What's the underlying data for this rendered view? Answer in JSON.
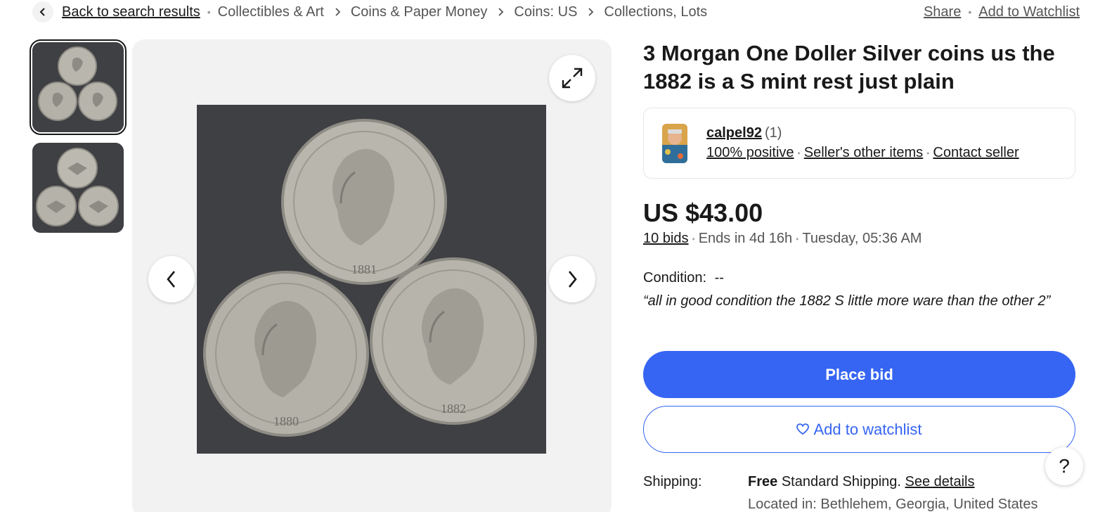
{
  "breadcrumb": {
    "back_label": "Back to search results",
    "items": [
      "Collectibles & Art",
      "Coins & Paper Money",
      "Coins: US",
      "Collections, Lots"
    ],
    "share_label": "Share",
    "watchlist_label": "Add to Watchlist"
  },
  "listing": {
    "title": "3 Morgan One Doller Silver coins us the 1882 is a S mint rest just plain",
    "coin_years": [
      "1881",
      "1880",
      "1882"
    ]
  },
  "seller": {
    "name": "calpel92",
    "count": "(1)",
    "feedback": "100% positive",
    "other_items": "Seller's other items",
    "contact": "Contact seller"
  },
  "pricing": {
    "price": "US $43.00",
    "bids": "10 bids",
    "ends_in": "Ends in 4d 16h",
    "end_time": "Tuesday, 05:36 AM"
  },
  "condition": {
    "label": "Condition:",
    "value": "--",
    "quote": "“all in good condition the 1882 S little more ware than the other 2”"
  },
  "actions": {
    "place_bid": "Place bid",
    "add_watchlist": "Add to watchlist",
    "help": "?"
  },
  "shipping": {
    "label": "Shipping:",
    "free": "Free",
    "service": "Standard Shipping.",
    "details": "See details",
    "located": "Located in: Bethlehem, Georgia, United States"
  },
  "colors": {
    "accent": "#3665f3",
    "text": "#191919",
    "muted": "#555555",
    "gallery_bg": "#f2f2f2"
  },
  "icons": [
    "chevron-left-icon",
    "chevron-right-icon",
    "expand-icon",
    "heart-icon",
    "help-icon"
  ]
}
